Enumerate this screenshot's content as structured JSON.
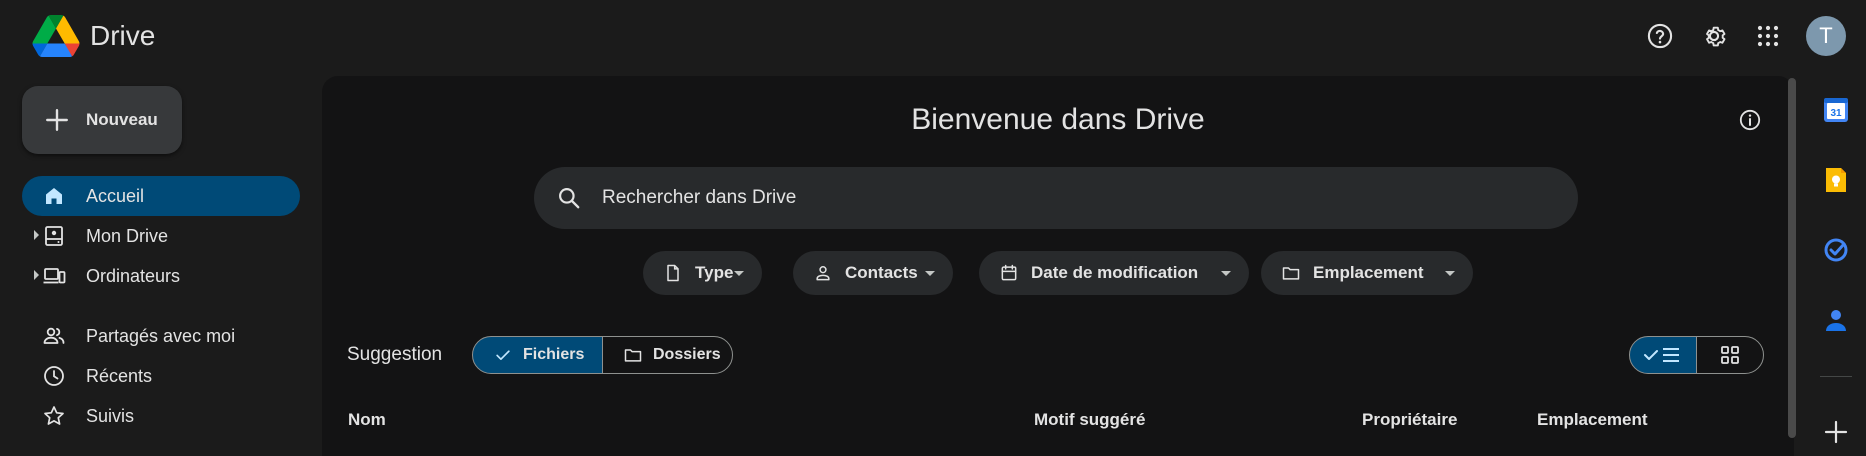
{
  "header": {
    "app_title": "Drive",
    "icons": [
      "help-icon",
      "gear-icon",
      "apps-grid-icon"
    ],
    "avatar_letter": "T"
  },
  "sidebar": {
    "new_label": "Nouveau",
    "items": [
      {
        "label": "Accueil",
        "icon": "home-icon",
        "active": true
      },
      {
        "label": "Mon Drive",
        "icon": "my-drive-icon",
        "expandable": true
      },
      {
        "label": "Ordinateurs",
        "icon": "computers-icon",
        "expandable": true
      },
      {
        "label": "Partagés avec moi",
        "icon": "shared-icon"
      },
      {
        "label": "Récents",
        "icon": "clock-icon"
      },
      {
        "label": "Suivis",
        "icon": "star-icon"
      }
    ]
  },
  "main": {
    "welcome_title": "Bienvenue dans Drive",
    "search_placeholder": "Rechercher dans Drive",
    "filters": [
      {
        "label": "Type",
        "icon": "file-icon"
      },
      {
        "label": "Contacts",
        "icon": "person-icon"
      },
      {
        "label": "Date de modification",
        "icon": "calendar-icon"
      },
      {
        "label": "Emplacement",
        "icon": "folder-icon"
      }
    ],
    "suggestion_label": "Suggestion",
    "toggle": {
      "files": "Fichiers",
      "folders": "Dossiers",
      "selected": "files"
    },
    "view_mode": "list",
    "columns": [
      "Nom",
      "Motif suggéré",
      "Propriétaire",
      "Emplacement"
    ]
  },
  "right_rail": {
    "apps": [
      "calendar-app-icon",
      "keep-app-icon",
      "tasks-app-icon",
      "contacts-app-icon",
      "add-icon"
    ],
    "calendar_day": "31"
  },
  "colors": {
    "background": "#1b1b1b",
    "surface": "#131314",
    "chip": "#282a2c",
    "accent_selected": "#004a77",
    "text": "#e3e3e3"
  }
}
